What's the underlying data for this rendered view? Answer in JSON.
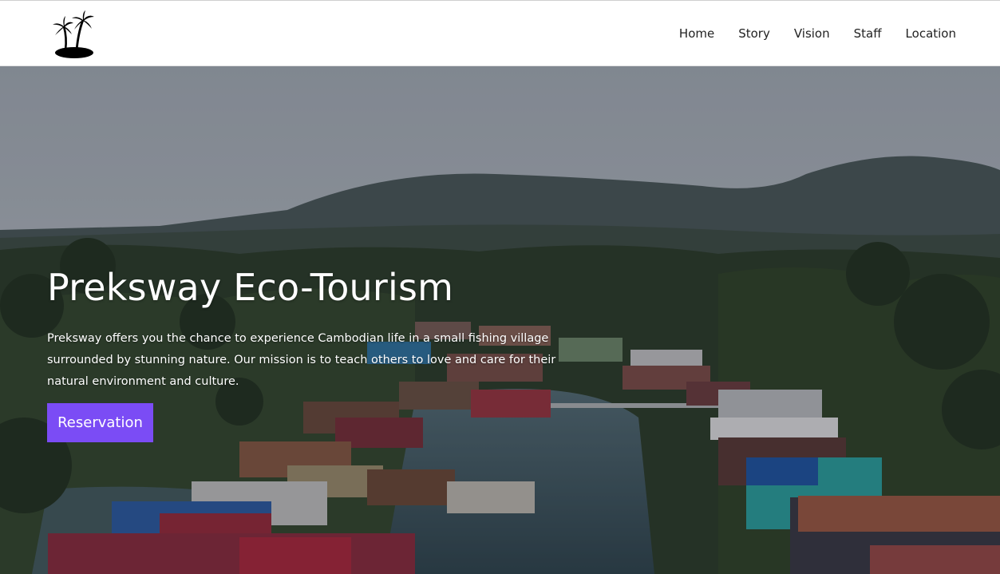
{
  "nav": {
    "logo_icon": "palm-island-icon",
    "links": [
      "Home",
      "Story",
      "Vision",
      "Staff",
      "Location"
    ]
  },
  "hero": {
    "title": "Preksway Eco-Tourism",
    "description": "Preksway offers you the chance to experience Cambodian life in a small fishing village surrounded by stunning nature. Our mission is to teach others to love and care for their natural environment and culture.",
    "cta_label": "Reservation",
    "cta_color": "#7b4cf5"
  }
}
